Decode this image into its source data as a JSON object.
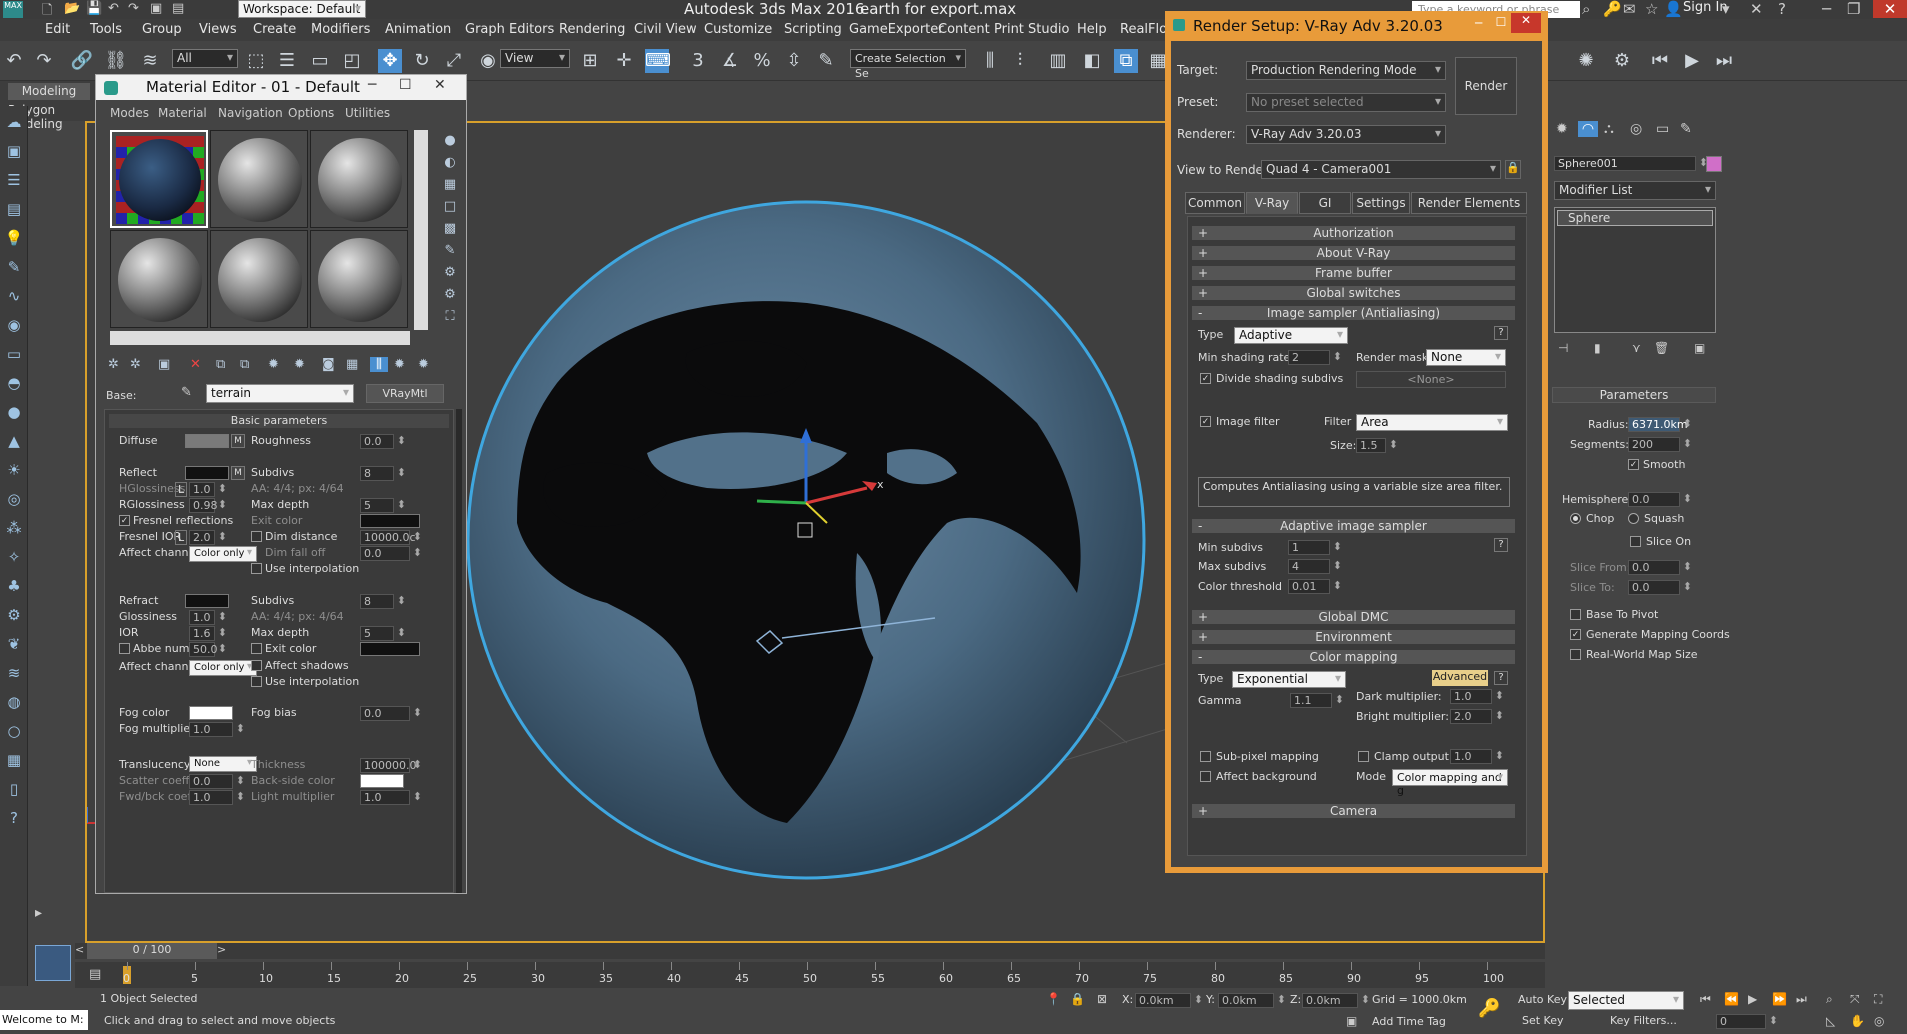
{
  "app": {
    "title": "Autodesk 3ds Max 2016",
    "file": "earth for export.max",
    "workspace": "Workspace: Default",
    "search_placeholder": "Type a keyword or phrase",
    "signin": "Sign In"
  },
  "menu": [
    "Edit",
    "Tools",
    "Group",
    "Views",
    "Create",
    "Modifiers",
    "Animation",
    "Graph Editors",
    "Rendering",
    "Civil View",
    "Customize",
    "Scripting",
    "GameExporter",
    "Content",
    "Print Studio",
    "Help",
    "RealFlow"
  ],
  "toolbar": {
    "selection_filter": "All",
    "ref_coord": "View",
    "named_selection": "Create Selection Se"
  },
  "ribbon": {
    "tab": "Modeling",
    "sub": "Polygon Modeling"
  },
  "material_editor": {
    "title": "Material Editor - 01 - Default",
    "menus": [
      "Modes",
      "Material",
      "Navigation",
      "Options",
      "Utilities"
    ],
    "base_label": "Base:",
    "material_name": "terrain",
    "material_type": "VRayMtl",
    "basic": {
      "header": "Basic parameters",
      "diffuse": "Diffuse",
      "roughness": "Roughness",
      "roughness_val": "0.0",
      "m": "M",
      "reflect": "Reflect",
      "subdivs": "Subdivs",
      "subdivs_val": "8",
      "hgloss": "HGlossiness",
      "l": "L",
      "hgloss_val": "1.0",
      "aa": "AA: 4/4; px: 4/64",
      "rgloss": "RGlossiness",
      "rgloss_val": "0.98",
      "maxdepth": "Max depth",
      "maxdepth_val": "5",
      "fresnel": "Fresnel reflections",
      "exit_color": "Exit color",
      "fresnel_ior": "Fresnel IOR",
      "fresnel_ior_val": "2.0",
      "dim_distance": "Dim distance",
      "dim_distance_val": "10000.0c",
      "dim_falloff": "Dim fall off",
      "dim_falloff_val": "0.0",
      "affect_channels": "Affect channels",
      "color_only": "Color only",
      "use_interp": "Use interpolation",
      "refract": "Refract",
      "glossiness": "Glossiness",
      "gloss_val": "1.0",
      "ior": "IOR",
      "ior_val": "1.6",
      "abbe": "Abbe number",
      "abbe_val": "50.0",
      "affect_shadows": "Affect shadows",
      "fog_color": "Fog color",
      "fog_bias": "Fog bias",
      "fog_bias_val": "0.0",
      "fog_mult": "Fog multiplier",
      "fog_mult_val": "1.0",
      "translucency": "Translucency",
      "transl_val": "None",
      "thickness": "Thickness",
      "thickness_val": "100000.0",
      "scatter": "Scatter coeff",
      "scatter_val": "0.0",
      "backside": "Back-side color",
      "fwdbck": "Fwd/bck coeff",
      "fwdbck_val": "1.0",
      "light_mult": "Light multiplier",
      "light_mult_val": "1.0"
    }
  },
  "render_setup": {
    "title": "Render Setup: V-Ray Adv 3.20.03",
    "target_label": "Target:",
    "target": "Production Rendering Mode",
    "preset_label": "Preset:",
    "preset": "No preset selected",
    "renderer_label": "Renderer:",
    "renderer": "V-Ray Adv 3.20.03",
    "view_label": "View to Render:",
    "view": "Quad 4 - Camera001",
    "render_btn": "Render",
    "tabs": [
      "Common",
      "V-Ray",
      "GI",
      "Settings",
      "Render Elements"
    ],
    "rollouts": {
      "auth": "Authorization",
      "about": "About V-Ray",
      "fb": "Frame buffer",
      "gs": "Global switches",
      "is": "Image sampler (Antialiasing)",
      "ais": "Adaptive image sampler",
      "dmc": "Global DMC",
      "env": "Environment",
      "cm": "Color mapping",
      "cam": "Camera"
    },
    "is": {
      "type_label": "Type",
      "type": "Adaptive",
      "min_shading": "Min shading rate",
      "min_shading_val": "2",
      "render_mask": "Render mask",
      "render_mask_val": "None",
      "divide": "Divide shading subdivs",
      "none_btn": "<None>",
      "image_filter": "Image filter",
      "filter_label": "Filter",
      "filter": "Area",
      "size_label": "Size:",
      "size": "1.5",
      "desc": "Computes Antialiasing using a variable size area filter.",
      "q": "?"
    },
    "ais": {
      "min_subdivs": "Min subdivs",
      "min_val": "1",
      "max_subdivs": "Max subdivs",
      "max_val": "4",
      "color_thr": "Color threshold",
      "thr_val": "0.01"
    },
    "cm": {
      "type_label": "Type",
      "type": "Exponential",
      "advanced": "Advanced",
      "gamma": "Gamma",
      "gamma_val": "1.1",
      "dark": "Dark multiplier:",
      "dark_val": "1.0",
      "bright": "Bright multiplier:",
      "bright_val": "2.0",
      "subpixel": "Sub-pixel mapping",
      "clamp": "Clamp output",
      "clamp_val": "1.0",
      "affect_bg": "Affect background",
      "mode_label": "Mode",
      "mode": "Color mapping and g"
    }
  },
  "command_panel": {
    "object": "Sphere001",
    "modifier_list": "Modifier List",
    "stack_item": "Sphere",
    "params": "Parameters",
    "radius": "Radius:",
    "radius_val": "6371.0km",
    "segments": "Segments:",
    "segments_val": "200",
    "smooth": "Smooth",
    "hemisphere": "Hemisphere:",
    "hemi_val": "0.0",
    "chop": "Chop",
    "squash": "Squash",
    "slice_on": "Slice On",
    "slice_from": "Slice From:",
    "slice_from_val": "0.0",
    "slice_to": "Slice To:",
    "slice_to_val": "0.0",
    "base_pivot": "Base To Pivot",
    "gen_map": "Generate Mapping Coords",
    "real_world": "Real-World Map Size"
  },
  "timeline": {
    "frame": "0 / 100",
    "ticks": [
      "0",
      "5",
      "10",
      "15",
      "20",
      "25",
      "30",
      "35",
      "40",
      "45",
      "50",
      "55",
      "60",
      "65",
      "70",
      "75",
      "80",
      "85",
      "90",
      "95",
      "100"
    ]
  },
  "status": {
    "selected": "1 Object Selected",
    "prompt": "Click and drag to select and move objects",
    "welcome": "Welcome to M:",
    "x_label": "X:",
    "x": "0.0km",
    "y_label": "Y:",
    "y": "0.0km",
    "z_label": "Z:",
    "z": "0.0km",
    "grid": "Grid = 1000.0km",
    "add_time_tag": "Add Time Tag",
    "auto_key": "Auto Key",
    "set_key": "Set Key",
    "sel_mode": "Selected",
    "key_filters": "Key Filters...",
    "frame_val": "0"
  },
  "viewport": {
    "axis_x": "x"
  },
  "colors": {
    "accent": "#e89b3a",
    "globe_outline": "#3fa7e0",
    "selected_tool": "#4a8fd0"
  }
}
